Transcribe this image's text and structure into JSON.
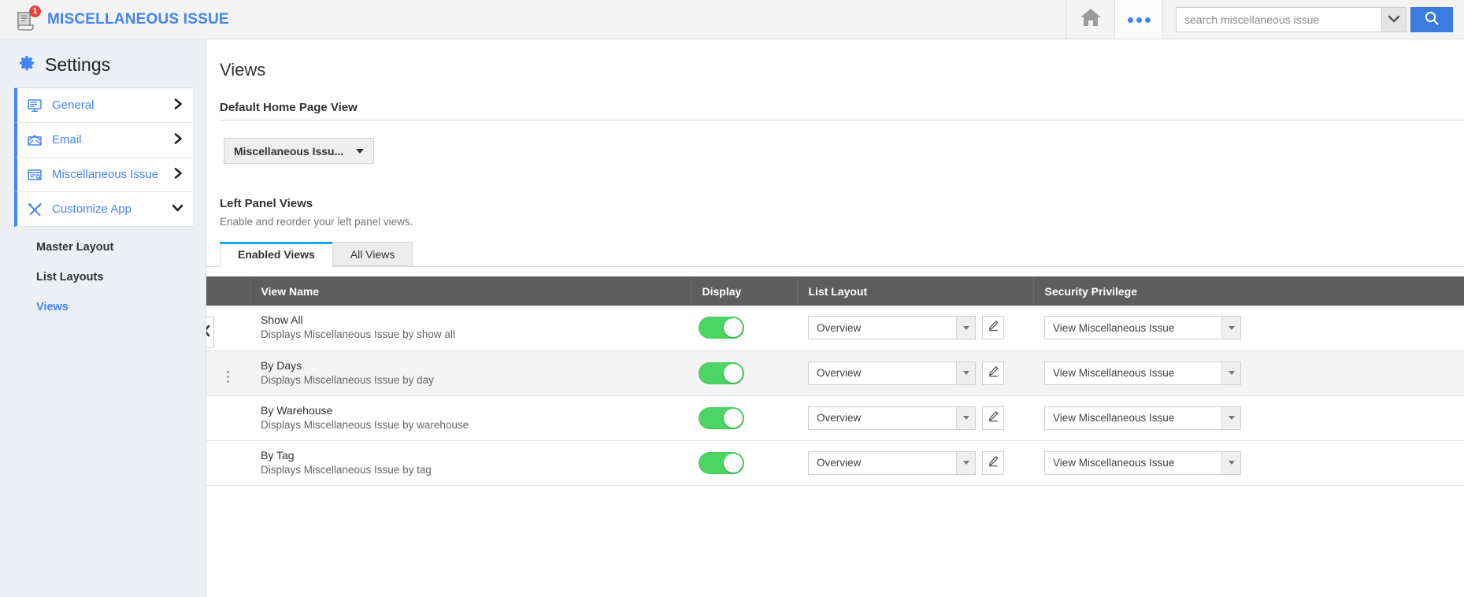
{
  "topbar": {
    "app_icon": "document-issue-icon",
    "badge_count": "1",
    "title": "MISCELLANEOUS ISSUE",
    "home_icon": "home-icon",
    "more_icon": "more-options-icon",
    "search_placeholder": "search miscellaneous issue",
    "search_value": "",
    "search_dropdown_icon": "chevron-down-icon",
    "search_button_icon": "search-icon",
    "accent_color": "#4285f4",
    "search_button_color": "#3b7ddd",
    "badge_color": "#e8453c"
  },
  "sidebar": {
    "title": "Settings",
    "gear_icon": "gear-icon",
    "items": [
      {
        "label": "General",
        "icon": "monitor-icon",
        "chevron": "❯"
      },
      {
        "label": "Email",
        "icon": "envelope-icon",
        "chevron": "❯"
      },
      {
        "label": "Miscellaneous Issue",
        "icon": "window-list-icon",
        "chevron": "❯"
      },
      {
        "label": "Customize App",
        "icon": "tools-icon",
        "chevron": "⌄"
      }
    ],
    "subitems": [
      {
        "label": "Master Layout",
        "active": false
      },
      {
        "label": "List Layouts",
        "active": false
      },
      {
        "label": "Views",
        "active": true
      }
    ]
  },
  "main": {
    "page_title": "Views",
    "default_home_page_view": {
      "label": "Default Home Page View",
      "selected": "Miscellaneous Issu..."
    },
    "left_panel_views": {
      "label": "Left Panel Views",
      "description": "Enable and reorder your left panel views."
    },
    "tabs": [
      {
        "label": "Enabled Views",
        "active": true
      },
      {
        "label": "All Views",
        "active": false
      }
    ],
    "table": {
      "columns": [
        "",
        "View Name",
        "Display",
        "List Layout",
        "Security Privilege"
      ],
      "rows": [
        {
          "name": "Show All",
          "description": "Displays Miscellaneous Issue by show all",
          "display_on": true,
          "list_layout": "Overview",
          "security_privilege": "View Miscellaneous Issue",
          "has_handle": false,
          "highlighted": false
        },
        {
          "name": "By Days",
          "description": "Displays Miscellaneous Issue by day",
          "display_on": true,
          "list_layout": "Overview",
          "security_privilege": "View Miscellaneous Issue",
          "has_handle": true,
          "highlighted": true
        },
        {
          "name": "By Warehouse",
          "description": "Displays Miscellaneous Issue by warehouse",
          "display_on": true,
          "list_layout": "Overview",
          "security_privilege": "View Miscellaneous Issue",
          "has_handle": false,
          "highlighted": false
        },
        {
          "name": "By Tag",
          "description": "Displays Miscellaneous Issue by tag",
          "display_on": true,
          "list_layout": "Overview",
          "security_privilege": "View Miscellaneous Issue",
          "has_handle": false,
          "highlighted": false
        }
      ],
      "edit_icon": "pencil-icon",
      "toggle_on_color": "#4cd464"
    },
    "collapse_handle_icon": "chevron-left-icon"
  }
}
